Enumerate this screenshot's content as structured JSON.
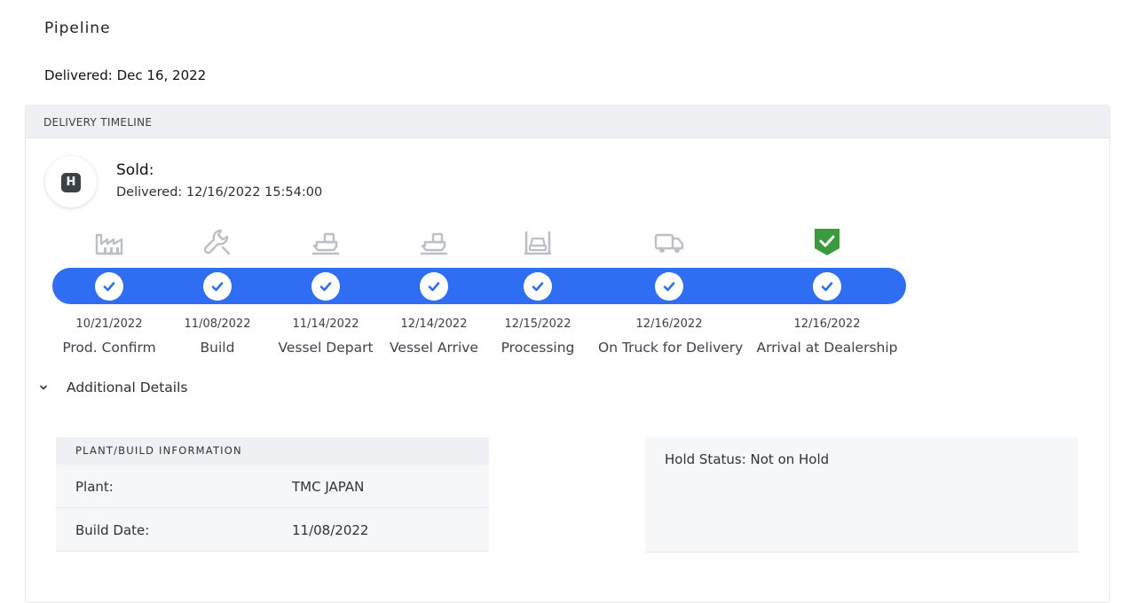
{
  "page": {
    "title": "Pipeline",
    "delivered_summary": "Delivered: Dec 16, 2022"
  },
  "timeline": {
    "header": "DELIVERY TIMELINE",
    "brand_letter": "H",
    "status_title": "Sold:",
    "status_detail": "Delivered: 12/16/2022 15:54:00",
    "bar_color": "#2f6ef2",
    "complete_color": "#3c9a3e",
    "steps": [
      {
        "date": "10/21/2022",
        "label": "Prod. Confirm",
        "icon": "factory-icon",
        "status": "done"
      },
      {
        "date": "11/08/2022",
        "label": "Build",
        "icon": "wrench-icon",
        "status": "done"
      },
      {
        "date": "11/14/2022",
        "label": "Vessel Depart",
        "icon": "ship-icon",
        "status": "done"
      },
      {
        "date": "12/14/2022",
        "label": "Vessel Arrive",
        "icon": "ship-icon",
        "status": "done"
      },
      {
        "date": "12/15/2022",
        "label": "Processing",
        "icon": "car-lift-icon",
        "status": "done"
      },
      {
        "date": "12/16/2022",
        "label": "On Truck for Delivery",
        "icon": "truck-icon",
        "status": "done"
      },
      {
        "date": "12/16/2022",
        "label": "Arrival at Dealership",
        "icon": "shield-check-icon",
        "status": "complete"
      }
    ]
  },
  "details": {
    "toggle_label": "Additional Details",
    "plant_header": "PLANT/BUILD INFORMATION",
    "plant_rows": [
      {
        "key": "Plant:",
        "value": "TMC JAPAN"
      },
      {
        "key": "Build Date:",
        "value": "11/08/2022"
      }
    ],
    "hold_status": "Hold Status: Not on Hold"
  }
}
